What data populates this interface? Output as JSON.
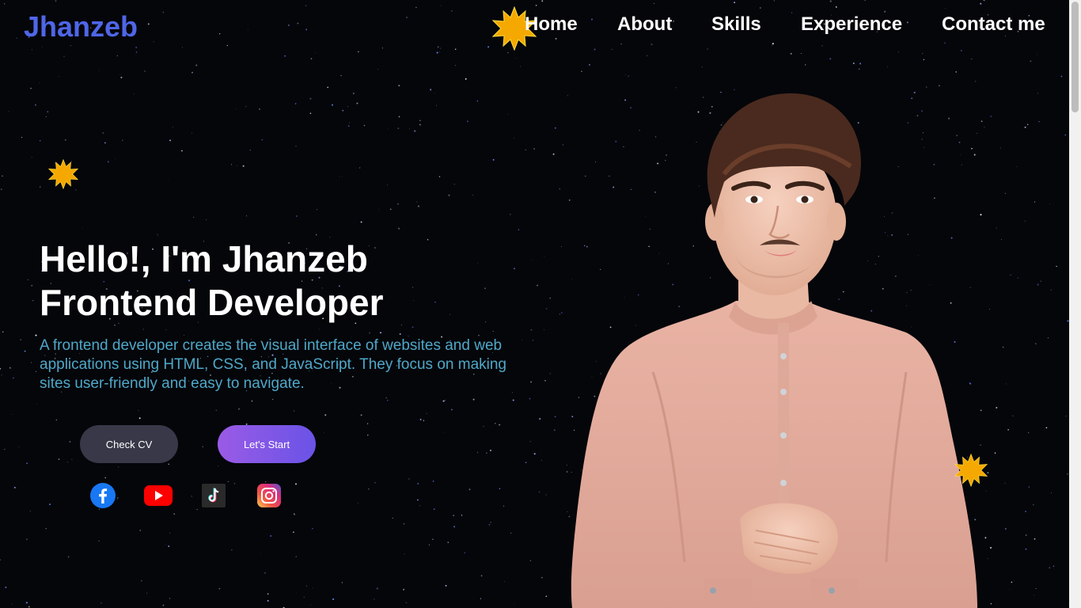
{
  "brand": {
    "name": "Jhanzeb"
  },
  "nav": {
    "home": "Home",
    "about": "About",
    "skills": "Skills",
    "experience": "Experience",
    "contact": "Contact me"
  },
  "hero": {
    "title_line1": "Hello!, I'm Jhanzeb",
    "title_line2": "Frontend Developer",
    "description": "A frontend developer creates the visual interface of websites and web applications using HTML, CSS, and JavaScript. They focus on making sites user-friendly and easy to navigate.",
    "buttons": {
      "check_cv": "Check CV",
      "lets_start": "Let's Start"
    }
  },
  "social": [
    {
      "icon": "facebook-icon"
    },
    {
      "icon": "youtube-icon"
    },
    {
      "icon": "tiktok-icon"
    },
    {
      "icon": "instagram-icon"
    }
  ],
  "colors": {
    "background": "#05060a",
    "brand": "#4f66e8",
    "description": "#4fa8c9",
    "accent_start": "#9a5be6",
    "accent_end": "#6a53e6",
    "burst": "#f5a800"
  }
}
